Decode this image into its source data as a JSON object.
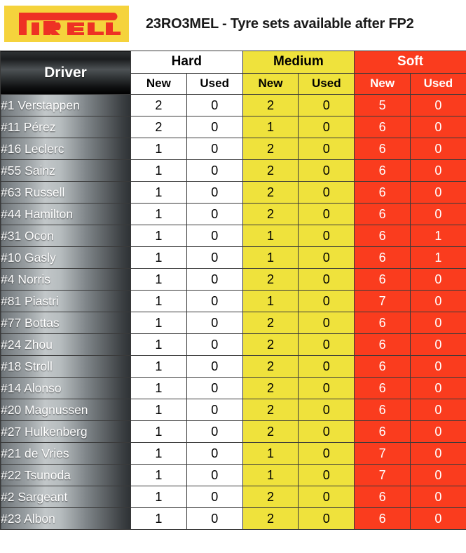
{
  "header": {
    "logo_alt": "PIRELLI",
    "logo_text": "PIRELLI",
    "logo_bg": "#F5D33C",
    "logo_fg": "#EE3124",
    "title": "23RO3MEL - Tyre sets available after FP2"
  },
  "colors": {
    "hard": "#FFFFFF",
    "medium": "#EFE23C",
    "soft": "#FA3C1E",
    "driver_dark": "#2E3235",
    "driver_light": "#C2C7C9"
  },
  "table": {
    "driver_header": "Driver",
    "compound_groups": [
      {
        "label": "Hard",
        "key": "hard"
      },
      {
        "label": "Medium",
        "key": "medium"
      },
      {
        "label": "Soft",
        "key": "soft"
      }
    ],
    "sub_headers": [
      "New",
      "Used",
      "New",
      "Used",
      "New",
      "Used"
    ],
    "rows": [
      {
        "driver": "#1 Verstappen",
        "hard_new": "2",
        "hard_used": "0",
        "medium_new": "2",
        "medium_used": "0",
        "soft_new": "5",
        "soft_used": "0"
      },
      {
        "driver": "#11 Pérez",
        "hard_new": "2",
        "hard_used": "0",
        "medium_new": "1",
        "medium_used": "0",
        "soft_new": "6",
        "soft_used": "0"
      },
      {
        "driver": "#16 Leclerc",
        "hard_new": "1",
        "hard_used": "0",
        "medium_new": "2",
        "medium_used": "0",
        "soft_new": "6",
        "soft_used": "0"
      },
      {
        "driver": "#55 Sainz",
        "hard_new": "1",
        "hard_used": "0",
        "medium_new": "2",
        "medium_used": "0",
        "soft_new": "6",
        "soft_used": "0"
      },
      {
        "driver": "#63 Russell",
        "hard_new": "1",
        "hard_used": "0",
        "medium_new": "2",
        "medium_used": "0",
        "soft_new": "6",
        "soft_used": "0"
      },
      {
        "driver": "#44 Hamilton",
        "hard_new": "1",
        "hard_used": "0",
        "medium_new": "2",
        "medium_used": "0",
        "soft_new": "6",
        "soft_used": "0"
      },
      {
        "driver": "#31 Ocon",
        "hard_new": "1",
        "hard_used": "0",
        "medium_new": "1",
        "medium_used": "0",
        "soft_new": "6",
        "soft_used": "1"
      },
      {
        "driver": "#10 Gasly",
        "hard_new": "1",
        "hard_used": "0",
        "medium_new": "1",
        "medium_used": "0",
        "soft_new": "6",
        "soft_used": "1"
      },
      {
        "driver": "#4 Norris",
        "hard_new": "1",
        "hard_used": "0",
        "medium_new": "2",
        "medium_used": "0",
        "soft_new": "6",
        "soft_used": "0"
      },
      {
        "driver": "#81 Piastri",
        "hard_new": "1",
        "hard_used": "0",
        "medium_new": "1",
        "medium_used": "0",
        "soft_new": "7",
        "soft_used": "0"
      },
      {
        "driver": "#77 Bottas",
        "hard_new": "1",
        "hard_used": "0",
        "medium_new": "2",
        "medium_used": "0",
        "soft_new": "6",
        "soft_used": "0"
      },
      {
        "driver": "#24 Zhou",
        "hard_new": "1",
        "hard_used": "0",
        "medium_new": "2",
        "medium_used": "0",
        "soft_new": "6",
        "soft_used": "0"
      },
      {
        "driver": "#18 Stroll",
        "hard_new": "1",
        "hard_used": "0",
        "medium_new": "2",
        "medium_used": "0",
        "soft_new": "6",
        "soft_used": "0"
      },
      {
        "driver": "#14 Alonso",
        "hard_new": "1",
        "hard_used": "0",
        "medium_new": "2",
        "medium_used": "0",
        "soft_new": "6",
        "soft_used": "0"
      },
      {
        "driver": "#20 Magnussen",
        "hard_new": "1",
        "hard_used": "0",
        "medium_new": "2",
        "medium_used": "0",
        "soft_new": "6",
        "soft_used": "0"
      },
      {
        "driver": "#27 Hulkenberg",
        "hard_new": "1",
        "hard_used": "0",
        "medium_new": "2",
        "medium_used": "0",
        "soft_new": "6",
        "soft_used": "0"
      },
      {
        "driver": "#21 de Vries",
        "hard_new": "1",
        "hard_used": "0",
        "medium_new": "1",
        "medium_used": "0",
        "soft_new": "7",
        "soft_used": "0"
      },
      {
        "driver": "#22 Tsunoda",
        "hard_new": "1",
        "hard_used": "0",
        "medium_new": "1",
        "medium_used": "0",
        "soft_new": "7",
        "soft_used": "0"
      },
      {
        "driver": "#2 Sargeant",
        "hard_new": "1",
        "hard_used": "0",
        "medium_new": "2",
        "medium_used": "0",
        "soft_new": "6",
        "soft_used": "0"
      },
      {
        "driver": "#23 Albon",
        "hard_new": "1",
        "hard_used": "0",
        "medium_new": "2",
        "medium_used": "0",
        "soft_new": "6",
        "soft_used": "0"
      }
    ]
  }
}
